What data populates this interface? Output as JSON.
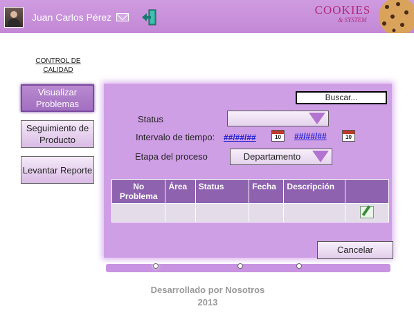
{
  "header": {
    "user_name": "Juan Carlos Pérez",
    "brand_main": "COOKIES",
    "brand_sub": "& SYSTEM"
  },
  "nav": {
    "title": "CONTROL DE CALIDAD",
    "items": [
      {
        "label": "Visualizar Problemas",
        "active": true
      },
      {
        "label": "Seguimiento de Producto",
        "active": false
      },
      {
        "label": "Levantar Reporte",
        "active": false
      }
    ]
  },
  "form": {
    "search_label": "Buscar...",
    "status_label": "Status",
    "status_value": "",
    "interval_label": "Intervalo de tiempo:",
    "date_from": "##/##/##",
    "date_to": "##/##/##",
    "calendar_day": "10",
    "stage_label": "Etapa del proceso",
    "stage_value": "Departamento"
  },
  "table": {
    "columns": [
      "No Problema",
      "Área",
      "Status",
      "Fecha",
      "Descripción",
      ""
    ],
    "rows": [
      [
        "",
        "",
        "",
        "",
        "",
        "edit-icon"
      ]
    ]
  },
  "actions": {
    "cancel_label": "Cancelar"
  },
  "progress": {
    "steps": 3,
    "current_step": 1
  },
  "footer": {
    "line1": "Desarrollado por Nosotros",
    "line2": "2013"
  },
  "colors": {
    "header": "#c893dc",
    "panel": "#cf9fe6",
    "table_header": "#8e62ae",
    "accent": "#b274d0",
    "date_link": "#2020d0"
  }
}
